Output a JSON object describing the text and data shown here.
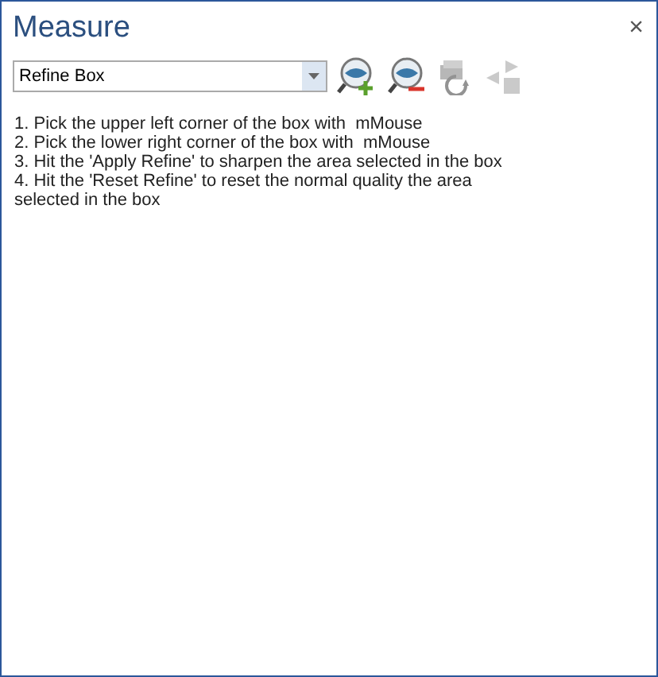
{
  "window": {
    "title": "Measure",
    "close": "×"
  },
  "mode_dropdown": {
    "value": "Refine Box"
  },
  "tools": [
    {
      "kind": "zoom-add",
      "disabled": false
    },
    {
      "kind": "zoom-remove",
      "disabled": false
    },
    {
      "kind": "reset",
      "disabled": true
    },
    {
      "kind": "step",
      "disabled": true
    }
  ],
  "instructions": [
    "1. Pick the upper left corner of the box with  mMouse",
    "2. Pick the lower right corner of the box with  mMouse",
    "3. Hit the 'Apply Refine' to sharpen the area selected in the box",
    "4. Hit the 'Reset Refine' to reset the normal quality the area selected in the box"
  ]
}
